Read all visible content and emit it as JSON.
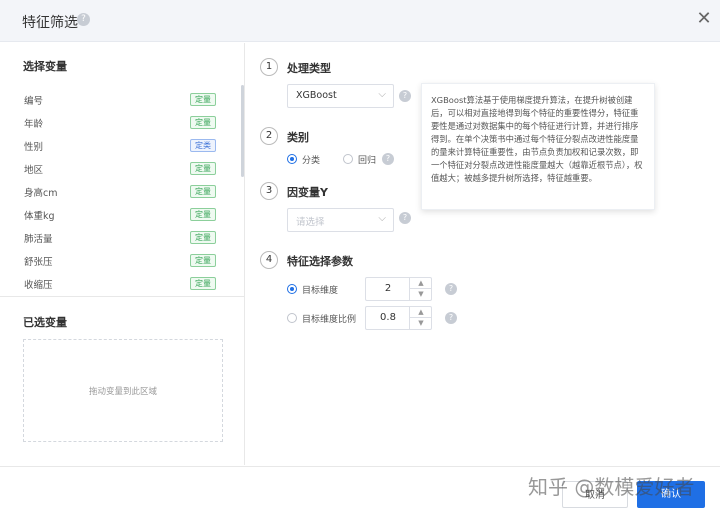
{
  "header": {
    "title": "特征筛选",
    "help_glyph": "?",
    "close_glyph": "✕"
  },
  "left": {
    "variables_title": "选择变量",
    "variables": [
      {
        "name": "编号",
        "tag": "定量",
        "tag_color": "green"
      },
      {
        "name": "年龄",
        "tag": "定量",
        "tag_color": "green"
      },
      {
        "name": "性别",
        "tag": "定类",
        "tag_color": "blue"
      },
      {
        "name": "地区",
        "tag": "定量",
        "tag_color": "green"
      },
      {
        "name": "身高cm",
        "tag": "定量",
        "tag_color": "green"
      },
      {
        "name": "体重kg",
        "tag": "定量",
        "tag_color": "green"
      },
      {
        "name": "肺活量",
        "tag": "定量",
        "tag_color": "green"
      },
      {
        "name": "舒张压",
        "tag": "定量",
        "tag_color": "green"
      },
      {
        "name": "收缩压",
        "tag": "定量",
        "tag_color": "green"
      }
    ],
    "selected_title": "已选变量",
    "dropzone_text": "拖动变量到此区域"
  },
  "steps": {
    "s1": {
      "num": "1",
      "label": "处理类型",
      "select_value": "XGBoost"
    },
    "s2": {
      "num": "2",
      "label": "类别",
      "options": [
        "分类",
        "回归"
      ],
      "selected": "分类"
    },
    "s3": {
      "num": "3",
      "label": "因变量Y",
      "placeholder": "请选择"
    },
    "s4": {
      "num": "4",
      "label": "特征选择参数",
      "opt1_label": "目标维度",
      "opt1_value": "2",
      "opt2_label": "目标维度比例",
      "opt2_value": "0.8"
    }
  },
  "tooltip": {
    "text": "XGBoost算法基于使用梯度提升算法，在提升树被创建后，可以相对直接地得到每个特征的重要性得分，特征重要性是通过对数据集中的每个特征进行计算，并进行排序得到。在单个决策书中通过每个特征分裂点改进性能度量的量来计算特征重要性，由节点负责加权和记录次数，即一个特征对分裂点改进性能度量越大（越靠近根节点），权值越大；被越多提升树所选择，特征越重要。"
  },
  "footer": {
    "cancel": "取消",
    "ok": "确认"
  },
  "watermark": "知乎 @数模爱好者",
  "colors": {
    "accent": "#1f6fe5",
    "tag_green": "#3aa55a",
    "tag_blue": "#3d72d7"
  }
}
